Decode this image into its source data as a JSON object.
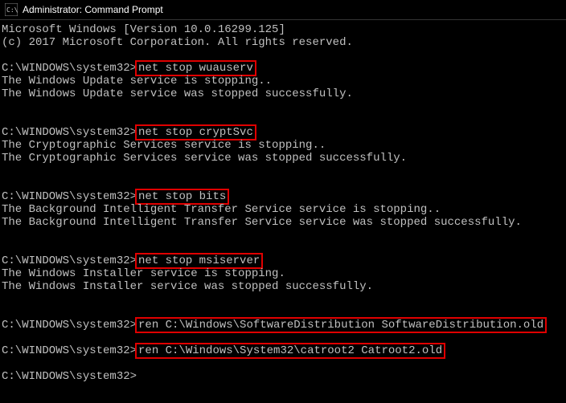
{
  "title": "Administrator: Command Prompt",
  "header": {
    "version_line": "Microsoft Windows [Version 10.0.16299.125]",
    "copyright_line": "(c) 2017 Microsoft Corporation. All rights reserved."
  },
  "prompt": "C:\\WINDOWS\\system32>",
  "blocks": [
    {
      "command": "net stop wuauserv",
      "output": [
        "The Windows Update service is stopping..",
        "The Windows Update service was stopped successfully."
      ]
    },
    {
      "command": "net stop cryptSvc",
      "output": [
        "The Cryptographic Services service is stopping..",
        "The Cryptographic Services service was stopped successfully."
      ]
    },
    {
      "command": "net stop bits",
      "output": [
        "The Background Intelligent Transfer Service service is stopping..",
        "The Background Intelligent Transfer Service service was stopped successfully."
      ]
    },
    {
      "command": "net stop msiserver",
      "output": [
        "The Windows Installer service is stopping.",
        "The Windows Installer service was stopped successfully."
      ]
    },
    {
      "command": "ren C:\\Windows\\SoftwareDistribution SoftwareDistribution.old",
      "output": []
    },
    {
      "command": "ren C:\\Windows\\System32\\catroot2 Catroot2.old",
      "output": []
    }
  ]
}
